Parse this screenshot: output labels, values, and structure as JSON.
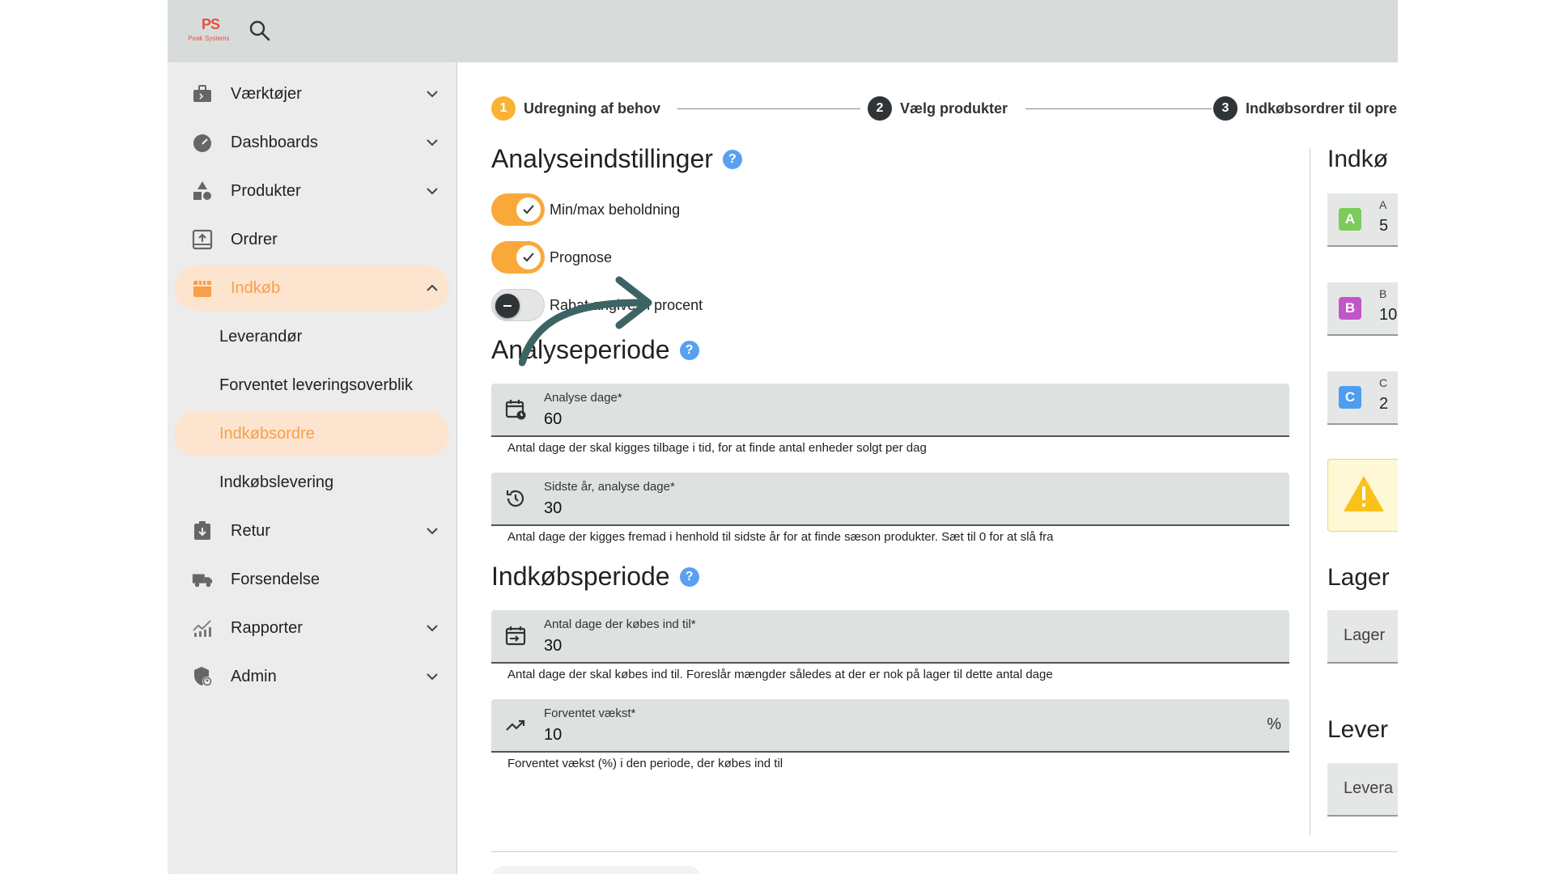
{
  "header": {
    "logo_mark": "PS",
    "logo_text": "Peak Systems",
    "search_icon": "search-icon"
  },
  "sidebar": {
    "items": [
      {
        "label": "Værktøjer",
        "icon": "toolbox-icon"
      },
      {
        "label": "Dashboards",
        "icon": "gauge-icon"
      },
      {
        "label": "Produkter",
        "icon": "shapes-icon"
      },
      {
        "label": "Ordrer",
        "icon": "inbox-upload-icon"
      },
      {
        "label": "Indkøb",
        "icon": "store-icon"
      },
      {
        "label": "Retur",
        "icon": "clipboard-return-icon"
      },
      {
        "label": "Forsendelse",
        "icon": "truck-icon"
      },
      {
        "label": "Rapporter",
        "icon": "chart-icon"
      },
      {
        "label": "Admin",
        "icon": "shield-user-icon"
      }
    ],
    "sub_items": [
      {
        "label": "Leverandør"
      },
      {
        "label": "Forventet leveringsoverblik"
      },
      {
        "label": "Indkøbsordre"
      },
      {
        "label": "Indkøbslevering"
      }
    ],
    "active_color": "#f6a04b"
  },
  "stepper": {
    "steps": [
      {
        "num": "1",
        "label": "Udregning af behov"
      },
      {
        "num": "2",
        "label": "Vælg produkter"
      },
      {
        "num": "3",
        "label": "Indkøbsordrer til opre"
      }
    ]
  },
  "analysis_settings": {
    "title": "Analyseindstillinger",
    "help": "?",
    "toggles": [
      {
        "label": "Min/max beholdning",
        "on": true
      },
      {
        "label": "Prognose",
        "on": true
      },
      {
        "label": "Rabat angives i procent",
        "on": false
      }
    ]
  },
  "analysis_period": {
    "title": "Analyseperiode",
    "help": "?",
    "fields": [
      {
        "label": "Analyse dage*",
        "value": "60",
        "hint": "Antal dage der skal kigges tilbage i tid, for at finde antal enheder solgt per dag"
      },
      {
        "label": "Sidste år, analyse dage*",
        "value": "30",
        "hint": "Antal dage der kigges fremad i henhold til sidste år for at finde sæson produkter. Sæt til 0 for at slå fra"
      }
    ]
  },
  "purchase_period": {
    "title": "Indkøbsperiode",
    "help": "?",
    "fields": [
      {
        "label": "Antal dage der købes ind til*",
        "value": "30",
        "hint": "Antal dage der skal købes ind til. Foreslår mængder således at der er nok på lager til dette antal dage"
      },
      {
        "label": "Forventet vækst*",
        "value": "10",
        "suffix": "%",
        "hint": "Forventet vækst (%) i den periode, der købes ind til"
      }
    ]
  },
  "right_panel": {
    "title": "Indkø",
    "cards": [
      {
        "badge": "A",
        "top": "A",
        "value": "5",
        "color": "#7ccb5b"
      },
      {
        "badge": "B",
        "top": "B",
        "value": "10",
        "color": "#c255c9"
      },
      {
        "badge": "C",
        "top": "C",
        "value": "2",
        "color": "#4d9ef0"
      }
    ],
    "warning_icon": "warning-icon",
    "lager_title": "Lager",
    "lager_select": "Lager",
    "lever_title": "Lever",
    "lever_select": "Levera"
  }
}
